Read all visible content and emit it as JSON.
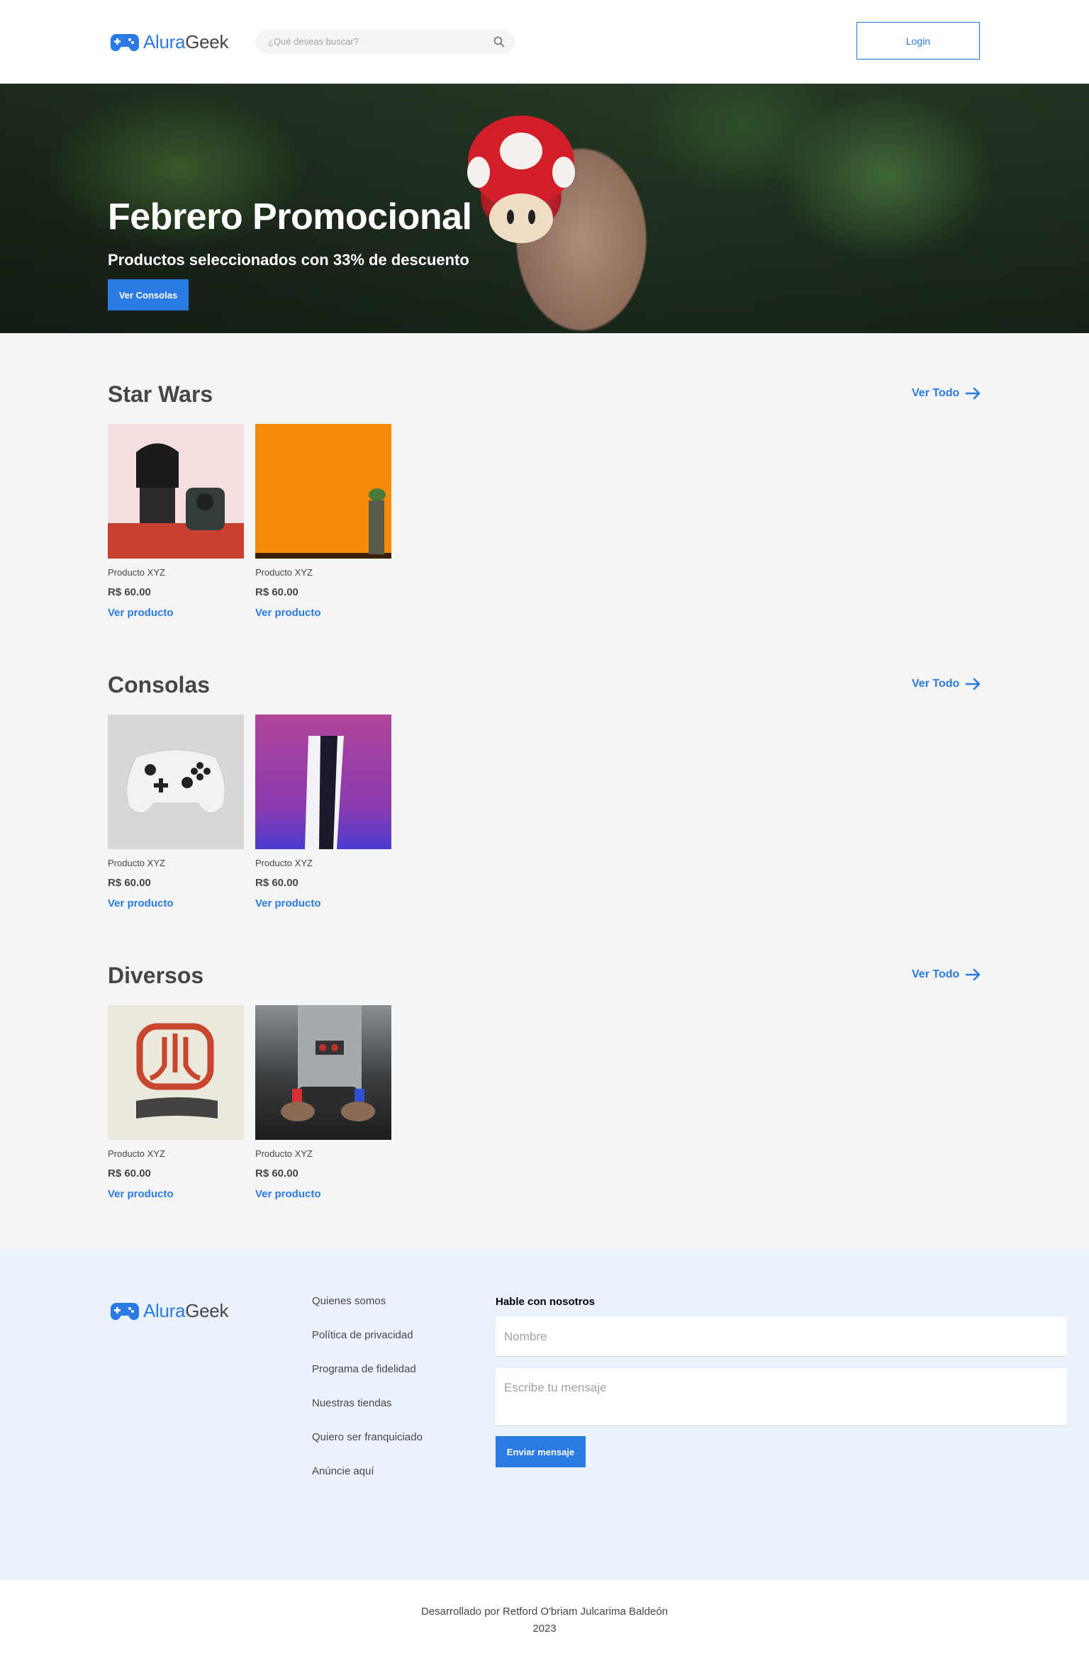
{
  "brand": {
    "name_blue": "Alura",
    "name_dark": "Geek",
    "accent": "#2a7ae4"
  },
  "header": {
    "search_placeholder": "¿Qué deseas buscar?",
    "search_icon": "search-icon",
    "login_label": "Login"
  },
  "hero": {
    "title": "Febrero Promocional",
    "subtitle": "Productos seleccionados con 33% de descuento",
    "button": "Ver Consolas"
  },
  "sections": [
    {
      "title": "Star Wars",
      "see_all": "Ver Todo",
      "products": [
        {
          "name": "Producto XYZ",
          "price": "R$ 60.00",
          "link": "Ver producto"
        },
        {
          "name": "Producto XYZ",
          "price": "R$ 60.00",
          "link": "Ver producto"
        }
      ]
    },
    {
      "title": "Consolas",
      "see_all": "Ver Todo",
      "products": [
        {
          "name": "Producto XYZ",
          "price": "R$ 60.00",
          "link": "Ver producto"
        },
        {
          "name": "Producto XYZ",
          "price": "R$ 60.00",
          "link": "Ver producto"
        }
      ]
    },
    {
      "title": "Diversos",
      "see_all": "Ver Todo",
      "products": [
        {
          "name": "Producto XYZ",
          "price": "R$ 60.00",
          "link": "Ver producto"
        },
        {
          "name": "Producto XYZ",
          "price": "R$ 60.00",
          "link": "Ver producto"
        }
      ]
    }
  ],
  "footer": {
    "links": [
      "Quienes somos",
      "Política de privacidad",
      "Programa de fidelidad",
      "Nuestras tiendas",
      "Quiero ser franquiciado",
      "Anúncie aquí"
    ],
    "form_title": "Hable con nosotros",
    "name_placeholder": "Nombre",
    "message_placeholder": "Escribe tu mensaje",
    "submit": "Enviar mensaje"
  },
  "credits": {
    "line1": "Desarrollado por Retford O'briam Julcarima Baldeón",
    "line2": "2023"
  }
}
